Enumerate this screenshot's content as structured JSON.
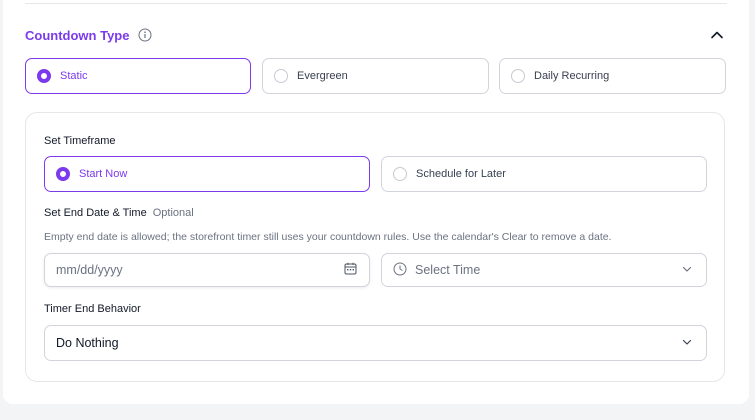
{
  "countdown_type": {
    "title": "Countdown Type",
    "options": [
      "Static",
      "Evergreen",
      "Daily Recurring"
    ],
    "selected_index": 0
  },
  "timeframe": {
    "label": "Set Timeframe",
    "options": [
      "Start Now",
      "Schedule for Later"
    ],
    "selected_index": 0
  },
  "end_date": {
    "label": "Set End Date & Time",
    "optional": "Optional",
    "helper": "Empty end date is allowed; the storefront timer still uses your countdown rules. Use the calendar's Clear to remove a date.",
    "date_placeholder": "mm/dd/yyyy",
    "time_placeholder": "Select Time"
  },
  "timer_end": {
    "label": "Timer End Behavior",
    "value": "Do Nothing"
  },
  "colors": {
    "accent": "#7c3aed",
    "border": "#d1d5db",
    "muted_text": "#6b7280"
  }
}
